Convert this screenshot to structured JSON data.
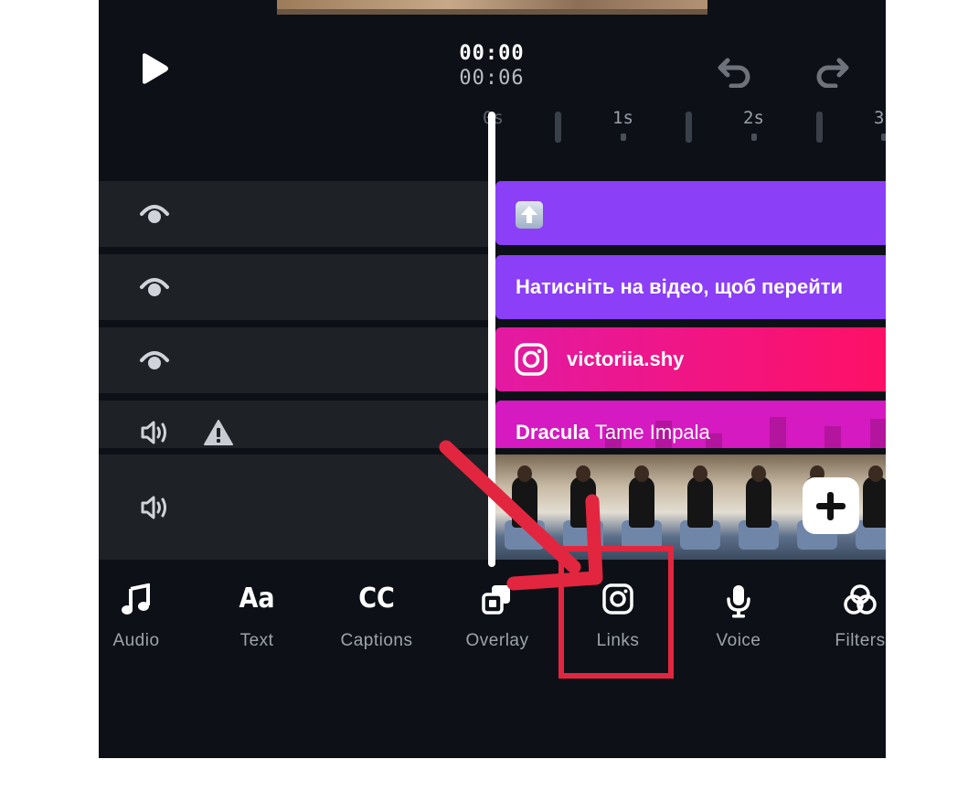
{
  "header": {
    "current_time": "00:00",
    "duration": "00:06"
  },
  "ruler": {
    "labels": [
      "0s",
      "1s",
      "2s",
      "3"
    ]
  },
  "tracks": [
    {
      "icon": "eye-icon"
    },
    {
      "icon": "eye-icon"
    },
    {
      "icon": "eye-icon"
    },
    {
      "icon": "speaker-icon",
      "warning_icon": "warning-icon"
    },
    {
      "icon": "speaker-icon"
    }
  ],
  "clips": {
    "upload_clip_icon": "upload-arrow-icon",
    "link_text": "Натисніть на відео, щоб перейти",
    "instagram_handle": "victoriia.shy",
    "song_title": "Dracula",
    "song_artist": "Tame Impala"
  },
  "toolbar": {
    "items": [
      {
        "label": "Audio",
        "icon": "music-note-icon"
      },
      {
        "label": "Text",
        "icon": "text-aa-icon",
        "glyph": "Aa"
      },
      {
        "label": "Captions",
        "icon": "captions-cc-icon",
        "glyph": "CC"
      },
      {
        "label": "Overlay",
        "icon": "overlay-icon"
      },
      {
        "label": "Links",
        "icon": "instagram-icon"
      },
      {
        "label": "Voice",
        "icon": "microphone-icon"
      },
      {
        "label": "Filters",
        "icon": "filters-icon"
      }
    ]
  },
  "colors": {
    "background": "#0d1117",
    "track_row": "#1e2227",
    "purple_clip": "#8b3ff6",
    "pink_clip": "#ff1064",
    "magenta_clip": "#d41ac0",
    "annotation": "#e3263f"
  }
}
